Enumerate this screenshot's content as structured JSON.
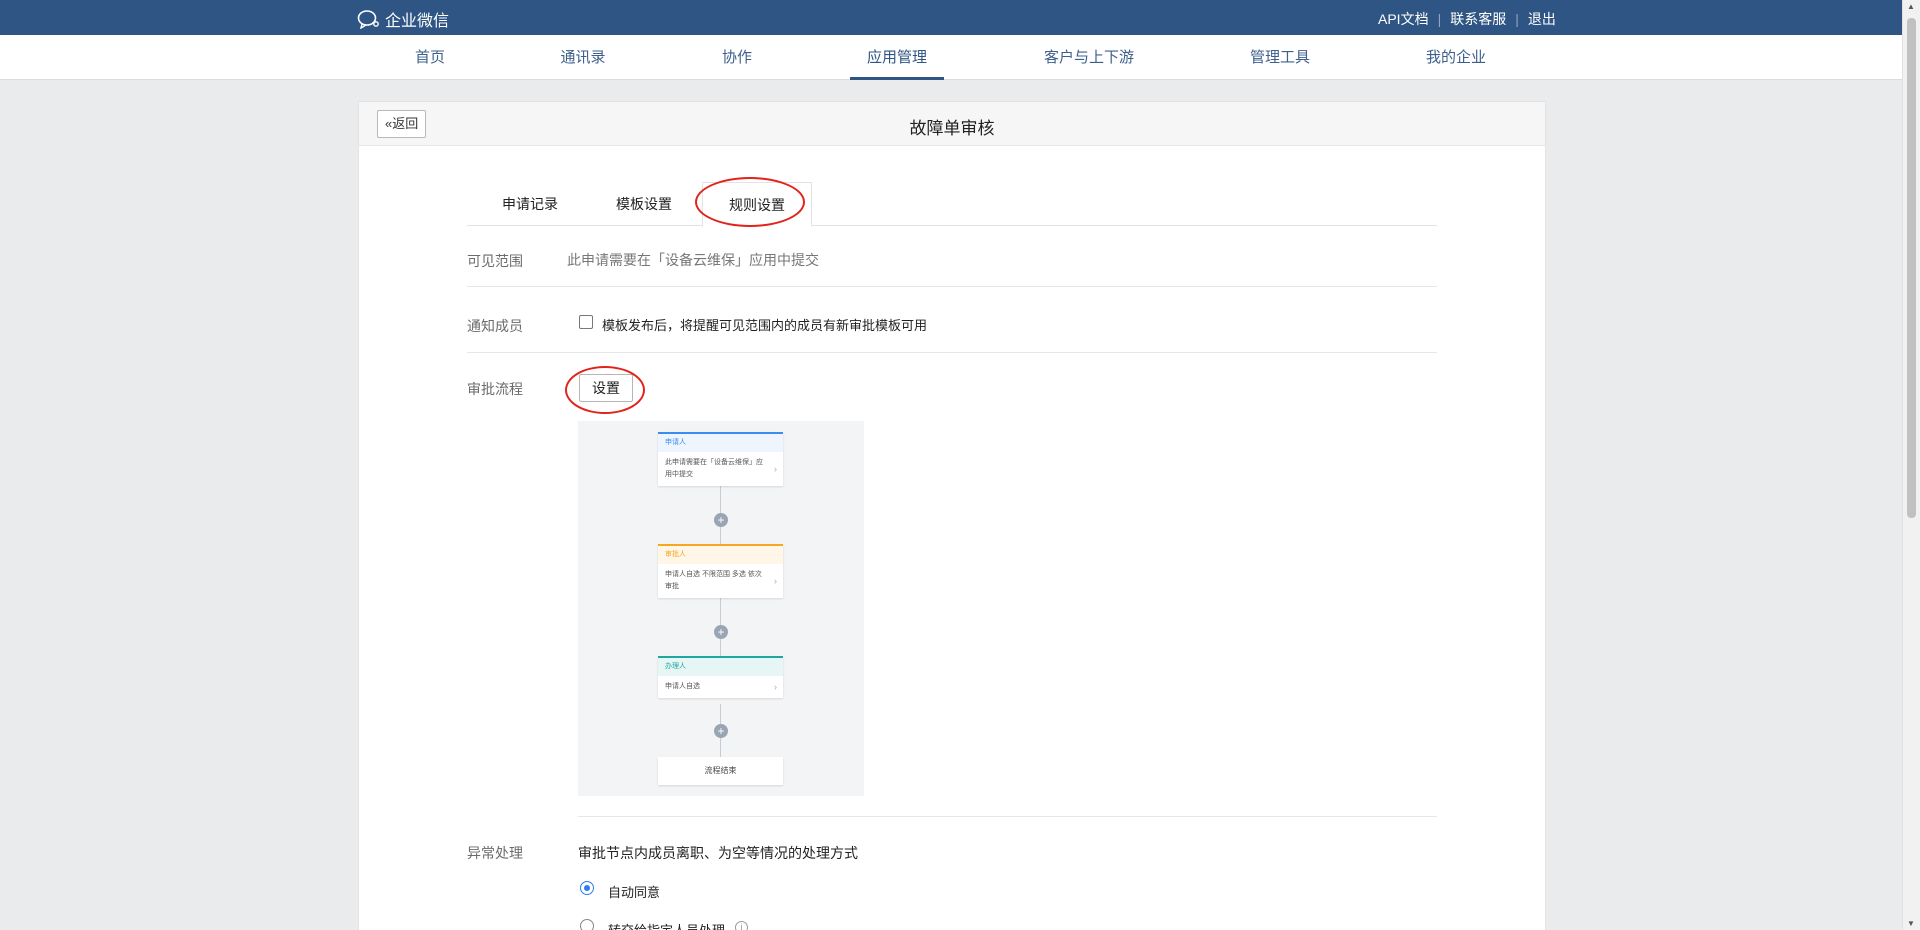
{
  "topbar": {
    "logo_text": "企业微信",
    "links": [
      "API文档",
      "联系客服",
      "退出"
    ]
  },
  "nav": {
    "items": [
      "首页",
      "通讯录",
      "协作",
      "应用管理",
      "客户与上下游",
      "管理工具",
      "我的企业"
    ],
    "active": "应用管理"
  },
  "card": {
    "back_label": "返回",
    "title": "故障单审核"
  },
  "tabs": {
    "items": [
      "申请记录",
      "模板设置",
      "规则设置"
    ],
    "active": "规则设置"
  },
  "rules": {
    "visibility_label": "可见范围",
    "visibility_hint": "此申请需要在「设备云维保」应用中提交",
    "notify_label": "通知成员",
    "notify_text": "模板发布后，将提醒可见范围内的成员有新审批模板可用",
    "notify_checked": false,
    "flow_label": "审批流程",
    "flow_button": "设置",
    "exception_label": "异常处理",
    "exception_desc": "审批节点内成员离职、为空等情况的处理方式",
    "exception_options": [
      {
        "label": "自动同意",
        "checked": true
      },
      {
        "label": "转交给指定人员处理",
        "checked": false
      }
    ]
  },
  "flow_preview": {
    "nodes": [
      {
        "header": "申请人",
        "body": "此申请需要在「设备云维保」应用中提交",
        "color": "#3b8cf0",
        "header_bg": "#eef5fe"
      },
      {
        "header": "审批人",
        "body": "申请人自选 不限范围 多选 依次审批",
        "color": "#f5a623",
        "header_bg": "#fff6e8"
      },
      {
        "header": "办理人",
        "body": "申请人自选",
        "color": "#1fa6a0",
        "header_bg": "#e6f6f5"
      }
    ],
    "end_label": "流程结束"
  },
  "colors": {
    "topbar": "#2f5584",
    "accent": "#2d7ee8",
    "highlight": "#e0241b"
  }
}
